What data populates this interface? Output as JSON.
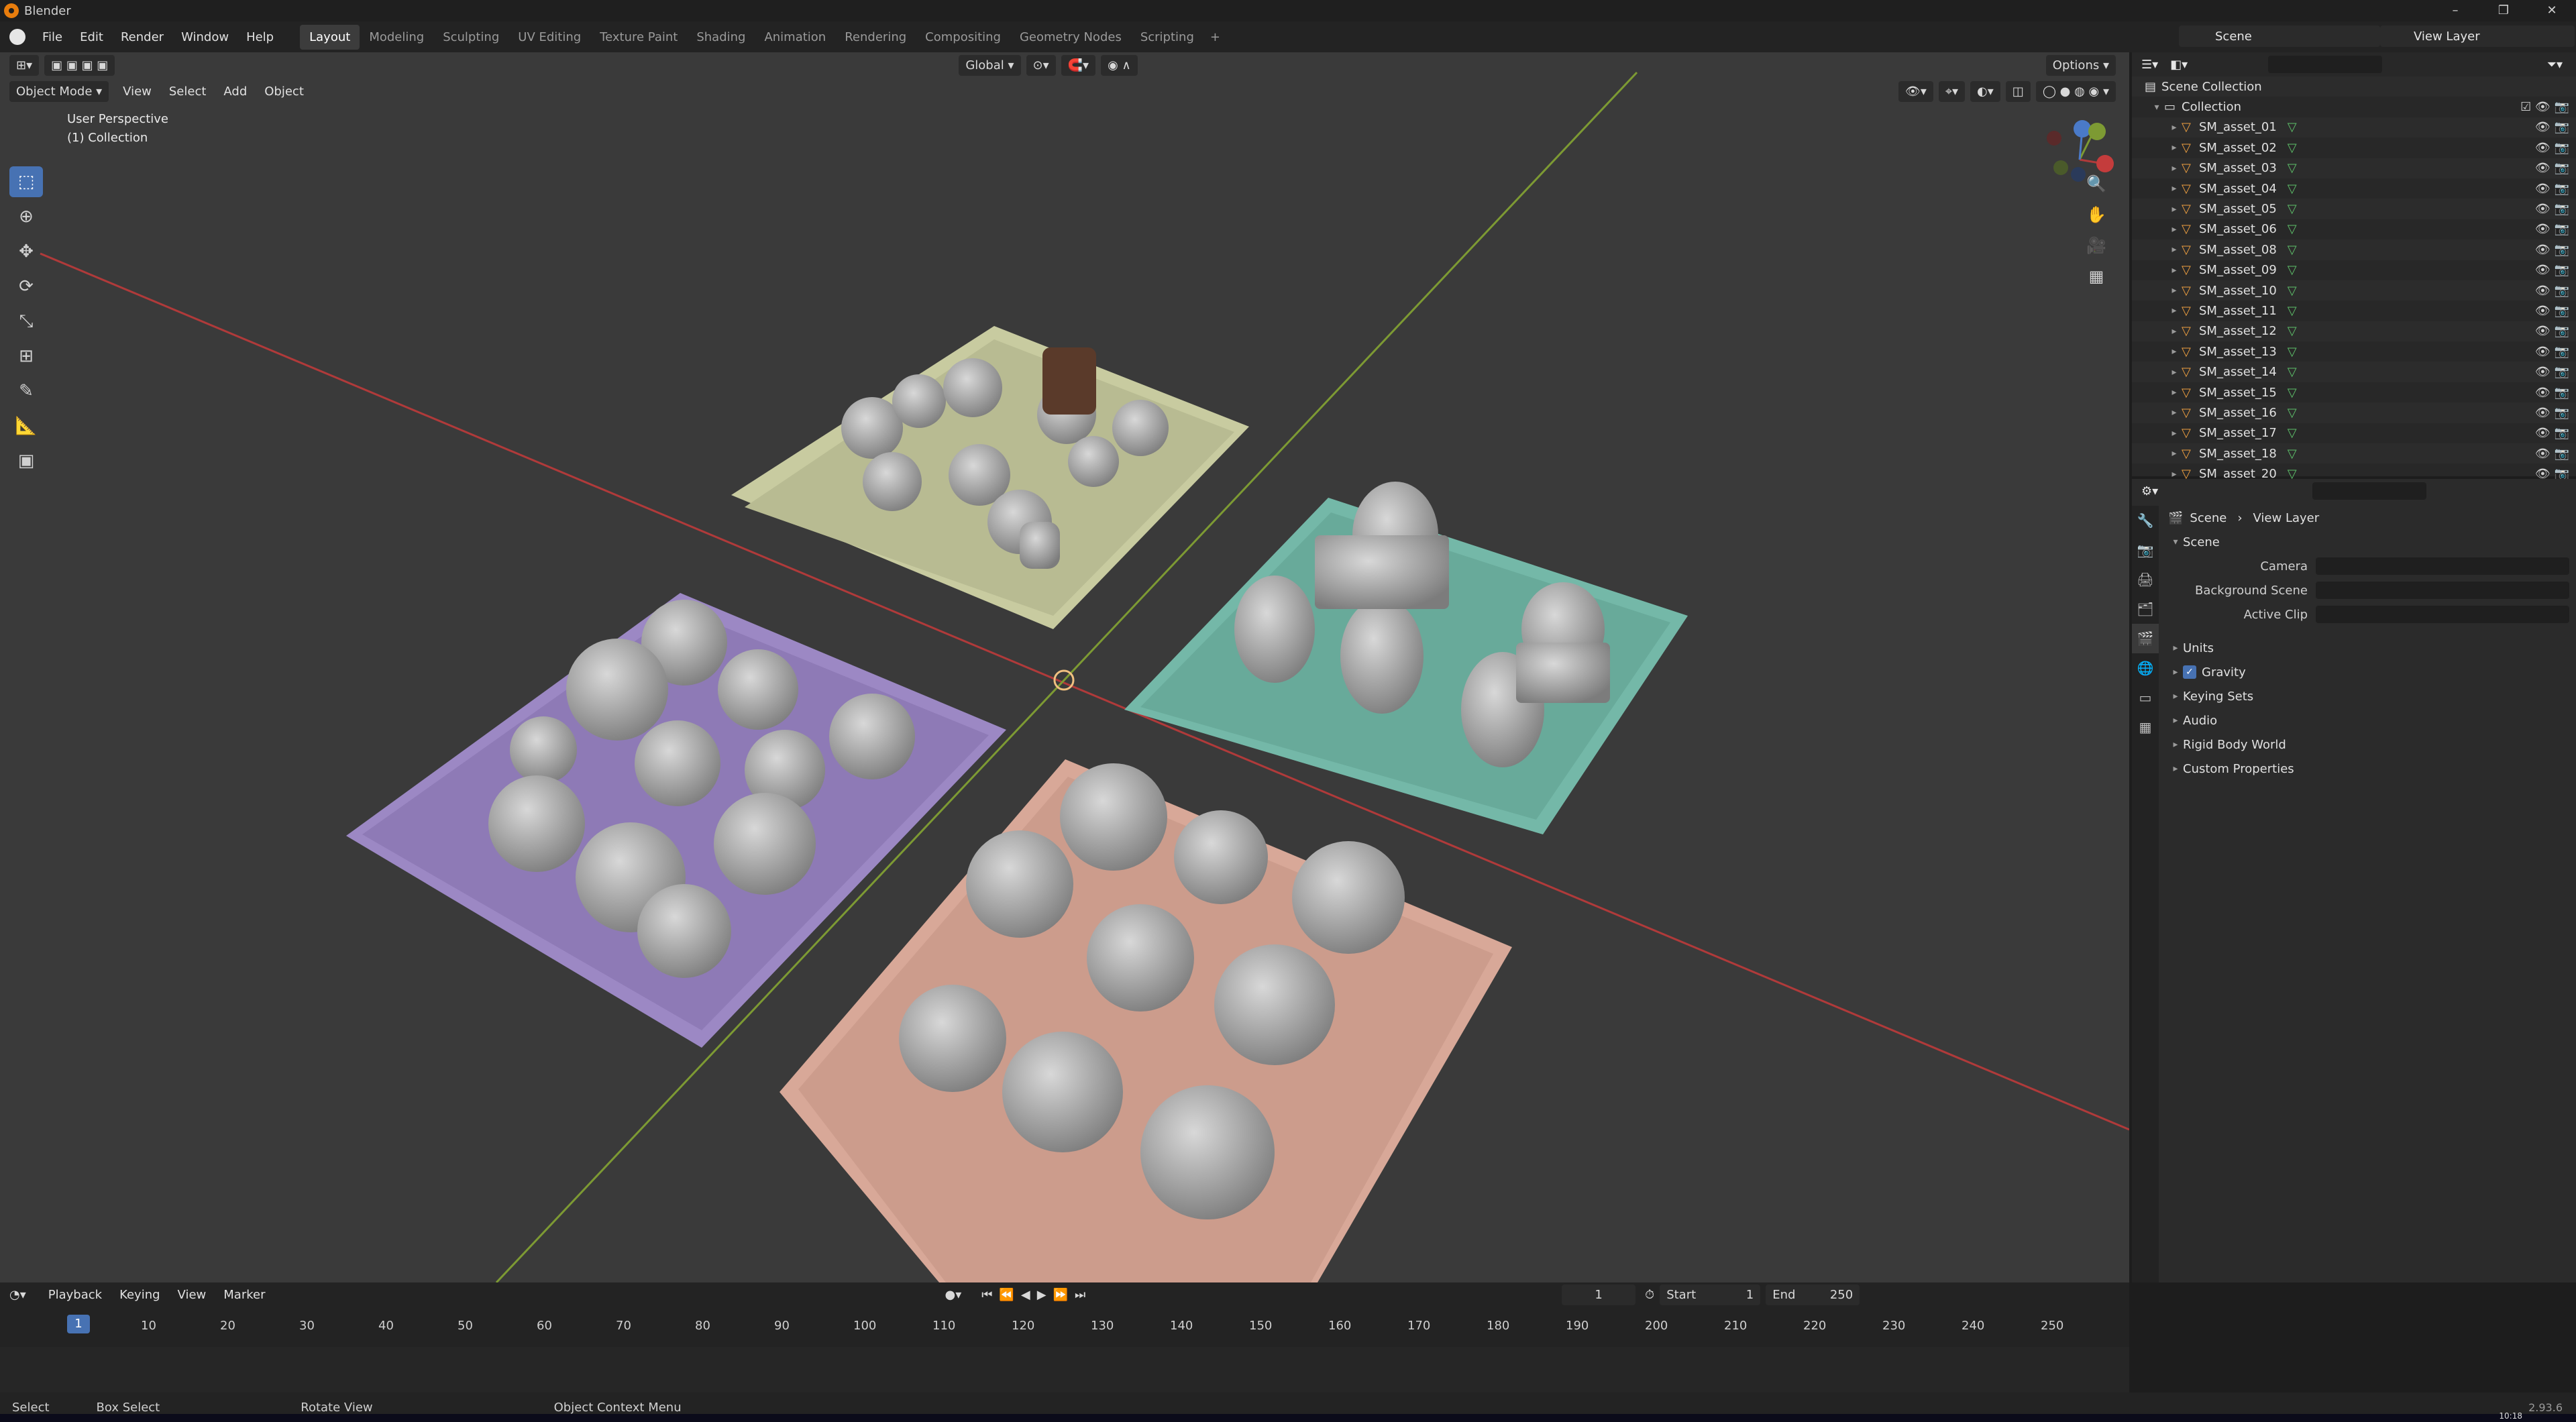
{
  "window": {
    "title": "Blender",
    "controls": [
      "–",
      "❐",
      "✕"
    ]
  },
  "menubar": {
    "items": [
      "File",
      "Edit",
      "Render",
      "Window",
      "Help"
    ]
  },
  "workspaces": {
    "tabs": [
      "Layout",
      "Modeling",
      "Sculpting",
      "UV Editing",
      "Texture Paint",
      "Shading",
      "Animation",
      "Rendering",
      "Compositing",
      "Geometry Nodes",
      "Scripting"
    ],
    "active": "Layout",
    "add": "+"
  },
  "scene_selector": {
    "value": "Scene"
  },
  "view_layer_selector": {
    "value": "View Layer"
  },
  "viewport": {
    "mode": "Object Mode",
    "menus": [
      "View",
      "Select",
      "Add",
      "Object"
    ],
    "transform_orientation": "Global",
    "options_label": "Options",
    "perspective_label": "User Perspective",
    "collection_label": "(1) Collection",
    "gizmo_axes": [
      "Z",
      "Y",
      "X"
    ]
  },
  "outliner": {
    "root": "Scene Collection",
    "collection": "Collection",
    "objects": [
      "SM_asset_01",
      "SM_asset_02",
      "SM_asset_03",
      "SM_asset_04",
      "SM_asset_05",
      "SM_asset_06",
      "SM_asset_08",
      "SM_asset_09",
      "SM_asset_10",
      "SM_asset_11",
      "SM_asset_12",
      "SM_asset_13",
      "SM_asset_14",
      "SM_asset_15",
      "SM_asset_16",
      "SM_asset_17",
      "SM_asset_18",
      "SM_asset_20"
    ]
  },
  "properties": {
    "breadcrumb": [
      "Scene",
      "View Layer"
    ],
    "section": "Scene",
    "fields": [
      {
        "label": "Camera"
      },
      {
        "label": "Background Scene"
      },
      {
        "label": "Active Clip"
      }
    ],
    "panels": [
      "Units",
      "Gravity",
      "Keying Sets",
      "Audio",
      "Rigid Body World",
      "Custom Properties"
    ],
    "gravity_checked": true
  },
  "timeline": {
    "menus": [
      "Playback",
      "Keying",
      "View",
      "Marker"
    ],
    "current_frame": "1",
    "start_label": "Start",
    "start": "1",
    "end_label": "End",
    "end": "250",
    "ticks": [
      "10",
      "20",
      "30",
      "40",
      "50",
      "60",
      "70",
      "80",
      "90",
      "100",
      "110",
      "120",
      "130",
      "140",
      "150",
      "160",
      "170",
      "180",
      "190",
      "200",
      "210",
      "220",
      "230",
      "240",
      "250"
    ],
    "cursor": "1"
  },
  "statusbar": {
    "items": [
      "Select",
      "Box Select",
      "Rotate View",
      "Object Context Menu"
    ],
    "version": "2.93.6",
    "clock": "10:18"
  },
  "colors": {
    "plate_yellow": "#c8cba0",
    "plate_teal": "#74b8a8",
    "plate_purple": "#9c88c4",
    "plate_pink": "#d8a898",
    "x_axis": "#c43c3c",
    "y_axis": "#8aa83a",
    "accent": "#4772b3"
  }
}
